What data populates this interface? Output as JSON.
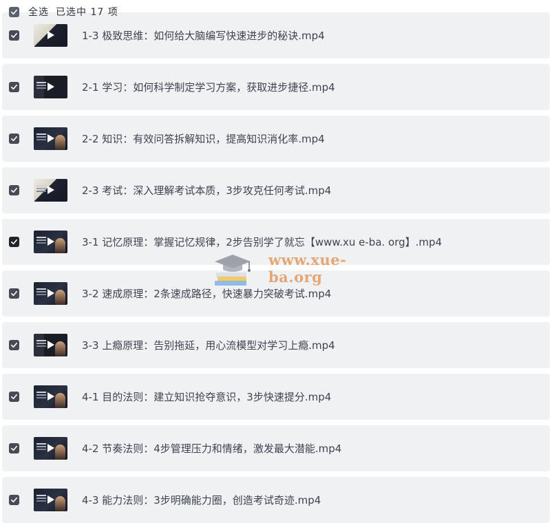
{
  "header": {
    "select_all_label": "全选",
    "selected_count_label": "已选中 17 项"
  },
  "files": [
    {
      "name": "1-3 极致思维：如何给大脑编写快速进步的秘诀.mp4",
      "checked": true
    },
    {
      "name": "2-1 学习：如何科学制定学习方案，获取进步捷径.mp4",
      "checked": true
    },
    {
      "name": "2-2 知识：有效问答拆解知识，提高知识消化率.mp4",
      "checked": true
    },
    {
      "name": "2-3 考试：深入理解考试本质，3步攻克任何考试.mp4",
      "checked": true
    },
    {
      "name": "3-1 记忆原理：掌握记忆规律，2步告别学了就忘【www.xu e-ba. org】.mp4",
      "checked": true
    },
    {
      "name": "3-2 速成原理：2条速成路径，快速暴力突破考试.mp4",
      "checked": true
    },
    {
      "name": "3-3 上瘾原理：告别拖延，用心流模型对学习上瘾.mp4",
      "checked": true
    },
    {
      "name": "4-1 目的法则：建立知识抢夺意识，3步快速提分.mp4",
      "checked": true
    },
    {
      "name": "4-2 节奏法则：4步管理压力和情绪，激发最大潜能.mp4",
      "checked": true
    },
    {
      "name": "4-3 能力法则：3步明确能力圈，创造考试奇迹.mp4",
      "checked": true
    }
  ],
  "watermark": {
    "text": "www.xue-ba.org",
    "icon": "graduation-cap-books-icon"
  }
}
